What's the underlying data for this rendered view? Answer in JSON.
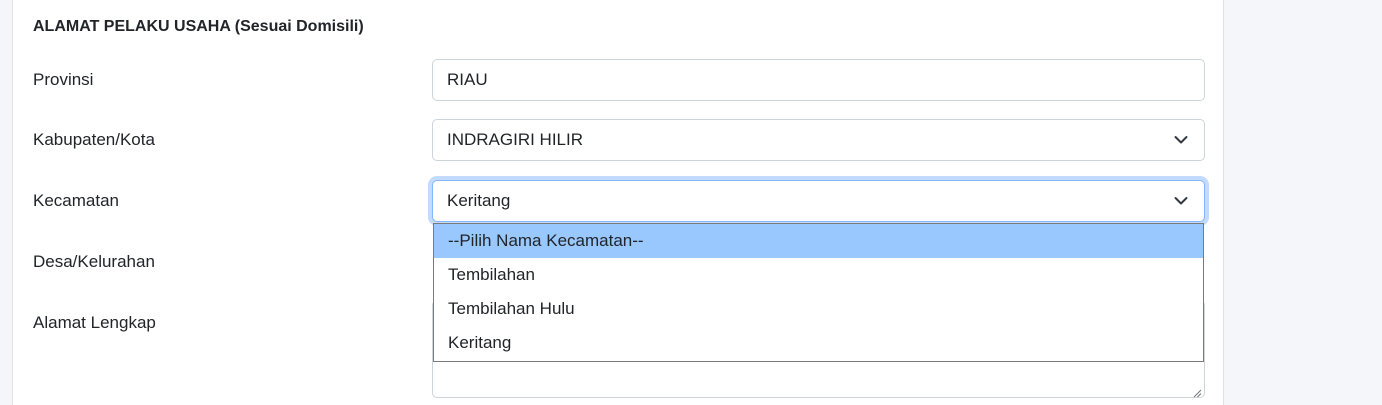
{
  "section": {
    "title": "ALAMAT PELAKU USAHA (Sesuai Domisili)"
  },
  "fields": {
    "provinsi": {
      "label": "Provinsi",
      "value": "RIAU"
    },
    "kabupaten": {
      "label": "Kabupaten/Kota",
      "value": "INDRAGIRI HILIR"
    },
    "kecamatan": {
      "label": "Kecamatan",
      "value": "Keritang"
    },
    "desa": {
      "label": "Desa/Kelurahan"
    },
    "alamat": {
      "label": "Alamat Lengkap",
      "value": ""
    }
  },
  "kecamatan_dropdown": {
    "options": [
      {
        "label": "--Pilih Nama Kecamatan--",
        "highlighted": true
      },
      {
        "label": "Tembilahan"
      },
      {
        "label": "Tembilahan Hulu"
      },
      {
        "label": "Keritang"
      }
    ]
  },
  "icons": {
    "select_arrow": "chevron-down-icon",
    "textarea_resize": "resize-grip-icon"
  },
  "colors": {
    "focus_border": "#86b7fe",
    "option_highlight": "#99c8ff",
    "input_border": "#ced4da",
    "page_side_background": "#f4f6f9"
  }
}
